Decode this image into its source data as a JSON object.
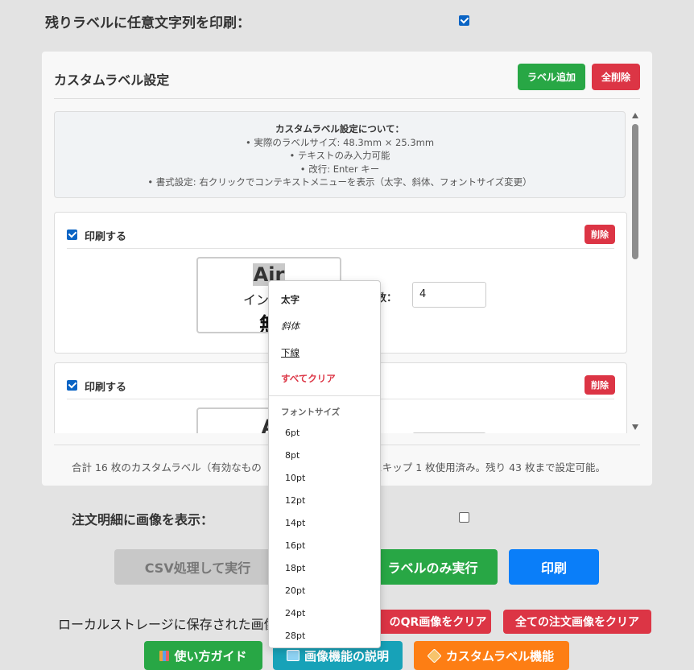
{
  "top_option": {
    "label": "残りラベルに任意文字列を印刷：",
    "checked": true
  },
  "panel": {
    "title": "カスタムラベル設定",
    "add_label": "ラベル追加",
    "delete_all": "全削除",
    "info": {
      "title": "カスタムラベル設定について：",
      "lines": [
        "• 実際のラベルサイズ: 48.3mm × 25.3mm",
        "• テキストのみ入力可能",
        "• 改行: Enter キー",
        "• 書式設定: 右クリックでコンテキストメニューを表示（太字、斜体、フォントサイズ変更）"
      ]
    },
    "cards": [
      {
        "print_label": "印刷する",
        "checked": true,
        "delete": "削除",
        "preview_line1": "Air",
        "preview_line2": "インサー",
        "preview_line3": "無",
        "qty_label": "枚数：",
        "qty_value": "4"
      },
      {
        "print_label": "印刷する",
        "checked": true,
        "delete": "削除",
        "preview_line1": "A"
      }
    ],
    "summary": "合計 16 枚のカスタムラベル（有効なもの　　　　　　　　　　　スキップ 1 枚使用済み。残り 43 枚まで設定可能。"
  },
  "order_image_option": {
    "label": "注文明細に画像を表示：",
    "checked": false
  },
  "actions": {
    "csv_run": "CSV処理して実行",
    "label_only": "ラベルのみ実行",
    "print": "印刷"
  },
  "storage": {
    "label": "ローカルストレージに保存された画像",
    "clear_qr": "のQR画像をクリア",
    "clear_orders": "全ての注文画像をクリア"
  },
  "guides": {
    "usage": "使い方ガイド",
    "image_feature": "画像機能の説明",
    "custom_label": "カスタムラベル機能"
  },
  "context_menu": {
    "bold": "太字",
    "italic": "斜体",
    "underline": "下線",
    "clear_all": "すべてクリア",
    "font_size_header": "フォントサイズ",
    "sizes": [
      "6pt",
      "8pt",
      "10pt",
      "12pt",
      "14pt",
      "16pt",
      "18pt",
      "20pt",
      "24pt",
      "28pt"
    ]
  },
  "colors": {
    "green": "#28a745",
    "red": "#dc3545",
    "blue": "#0a7ef9",
    "teal": "#17a2b8",
    "orange": "#fd7e14",
    "checkbox": "#0a64c4"
  }
}
